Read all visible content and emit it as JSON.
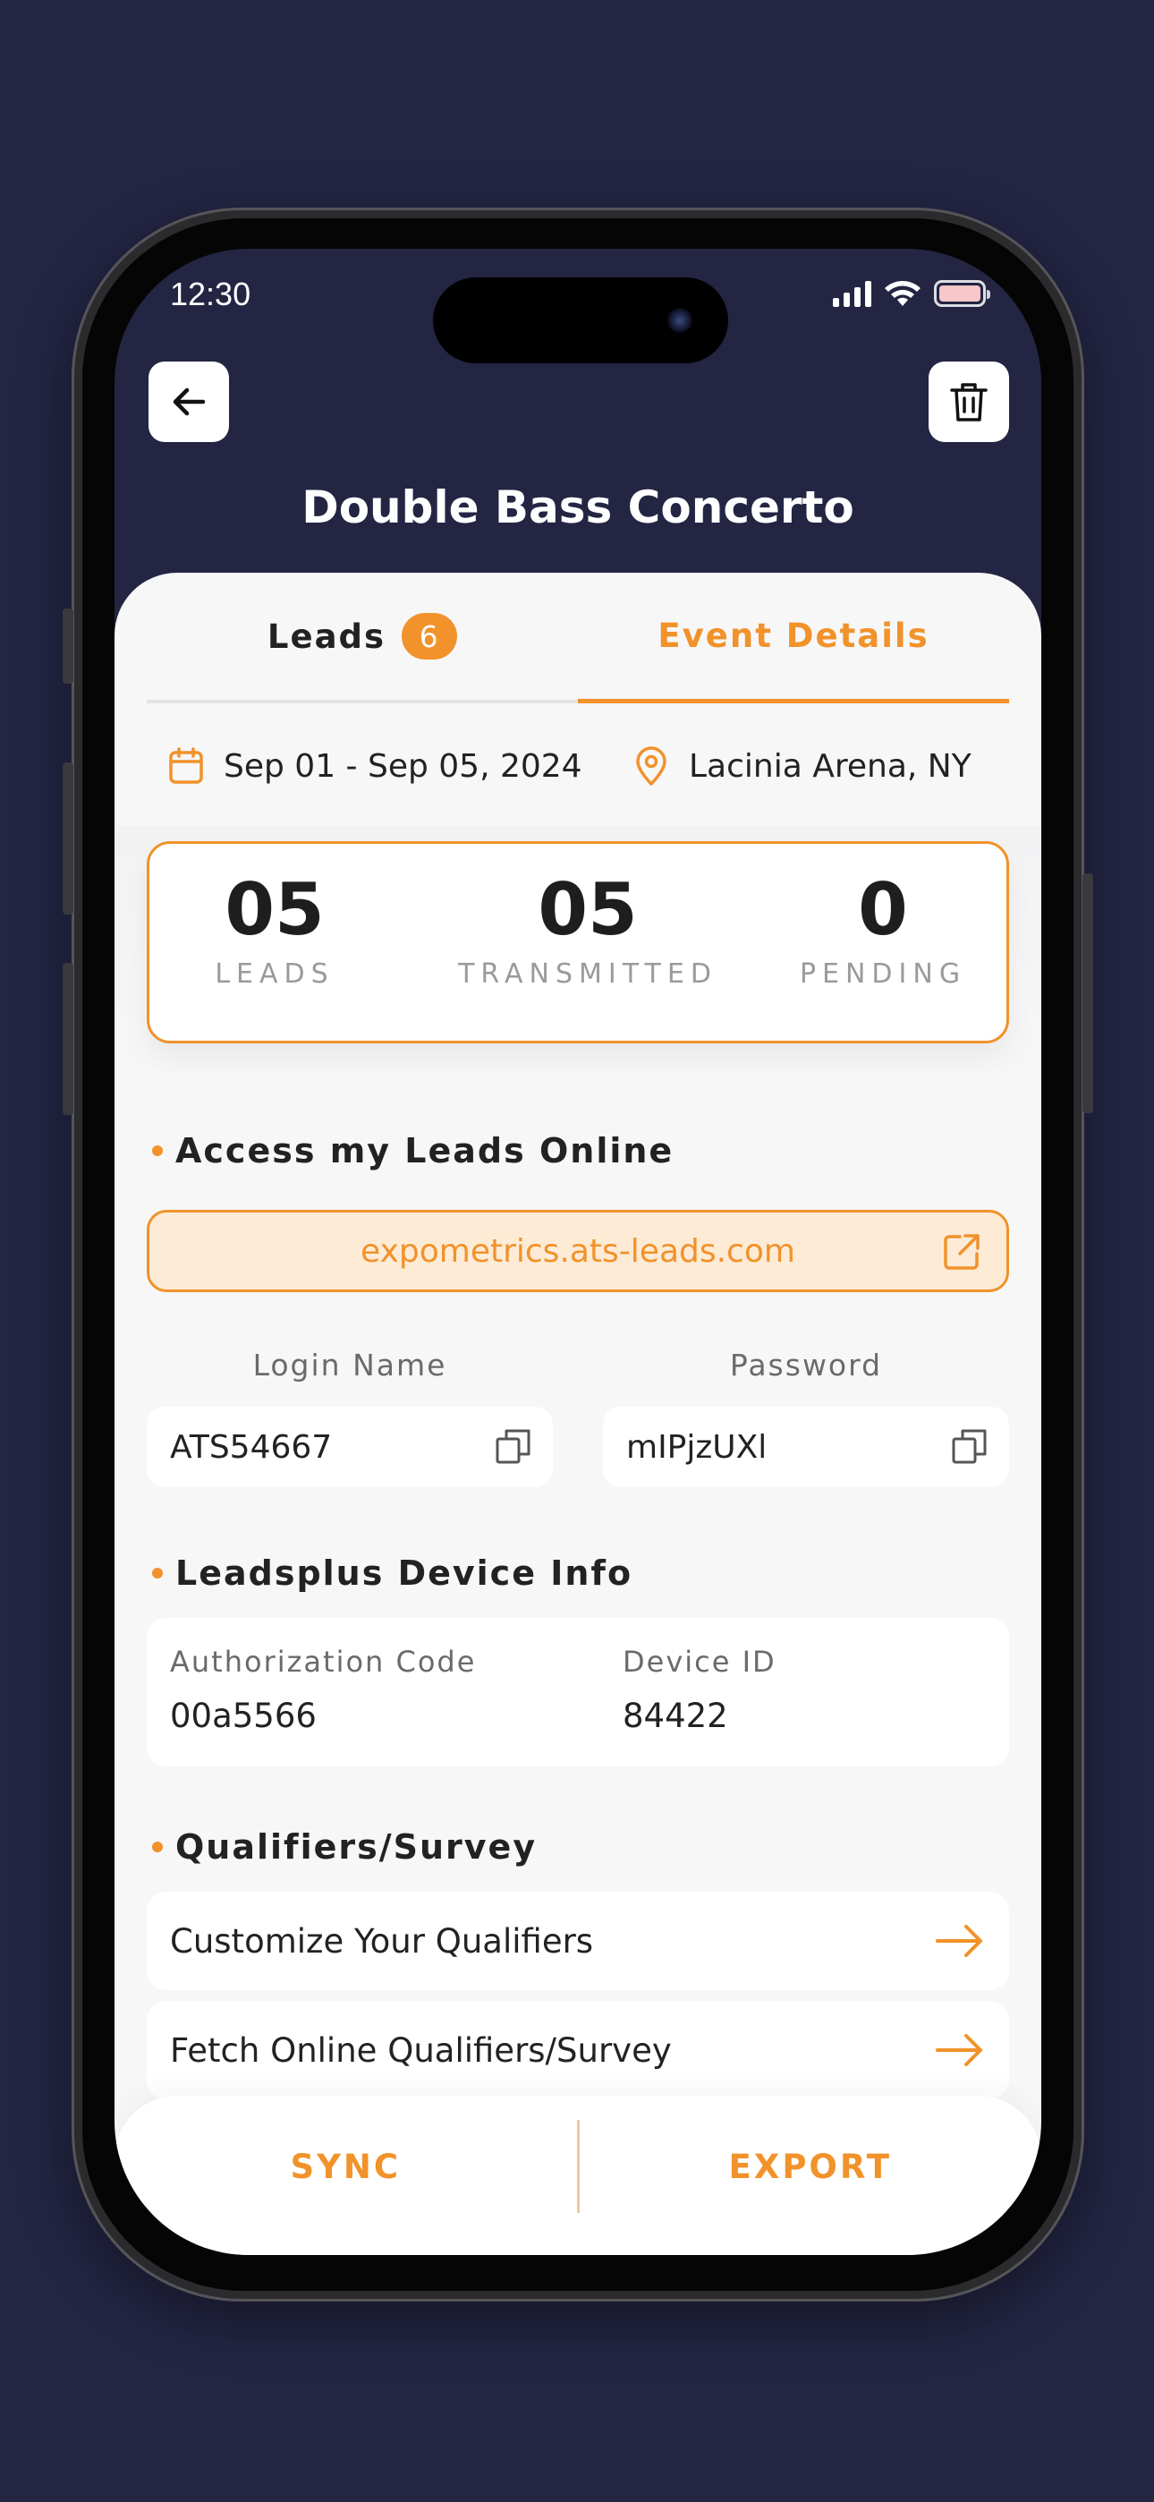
{
  "status_bar": {
    "time": "12:30"
  },
  "header": {
    "title": "Double Bass Concerto"
  },
  "tabs": [
    {
      "label": "Leads",
      "badge": "6",
      "active": false
    },
    {
      "label": "Event Details",
      "active": true
    }
  ],
  "event": {
    "date_range": "Sep 01 - Sep 05, 2024",
    "location": "Lacinia Arena, NY"
  },
  "stats": [
    {
      "value": "05",
      "label": "LEADS"
    },
    {
      "value": "05",
      "label": "TRANSMITTED"
    },
    {
      "value": "0",
      "label": "PENDING"
    }
  ],
  "access": {
    "section_title": "Access my Leads Online",
    "url": "expometrics.ats-leads.com",
    "login_label": "Login Name",
    "login_value": "ATS54667",
    "password_label": "Password",
    "password_value": "mIPjzUXl"
  },
  "device": {
    "section_title": "Leadsplus Device Info",
    "auth_label": "Authorization Code",
    "auth_value": "00a5566",
    "device_label": "Device ID",
    "device_value": "84422"
  },
  "qualifiers": {
    "section_title": "Qualifiers/Survey",
    "items": [
      "Customize Your Qualifiers",
      "Fetch Online Qualifiers/Survey"
    ]
  },
  "bottom": {
    "sync": "SYNC",
    "export": "EXPORT"
  },
  "colors": {
    "accent": "#f1922a",
    "background": "#232543",
    "sheet": "#f7f7f8"
  },
  "icons": [
    "back-arrow-icon",
    "trash-icon",
    "calendar-icon",
    "location-pin-icon",
    "external-link-icon",
    "copy-icon",
    "arrow-right-icon"
  ]
}
